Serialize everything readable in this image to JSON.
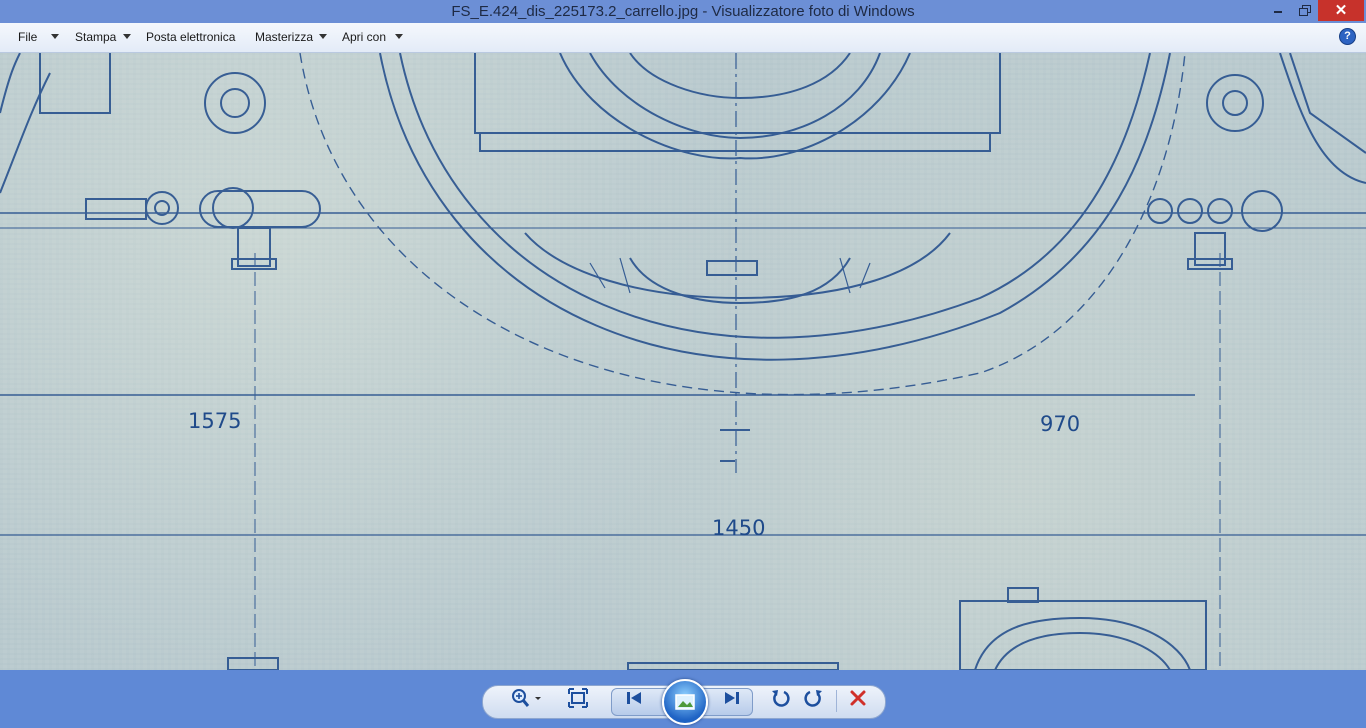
{
  "window": {
    "title": "FS_E.424_dis_225173.2_carrello.jpg - Visualizzatore foto di Windows",
    "close_glyph": "✕"
  },
  "menu": {
    "items": [
      {
        "label": "File"
      },
      {
        "label": "Stampa"
      },
      {
        "label": "Posta elettronica"
      },
      {
        "label": "Masterizza"
      },
      {
        "label": "Apri con"
      }
    ],
    "help_glyph": "?"
  },
  "image": {
    "dimensions": [
      "1575",
      "970",
      "1450"
    ]
  },
  "toolbar": {
    "icons": [
      "zoom-icon",
      "actual-size-icon",
      "previous-icon",
      "slideshow-icon",
      "next-icon",
      "rotate-counterclockwise-icon",
      "rotate-clockwise-icon",
      "delete-icon"
    ]
  },
  "colors": {
    "title_bar": "#6c8fd6",
    "close_button": "#c7322b",
    "blueprint_ink": "#1f4a8a",
    "bottom_bar": "#5f89d6"
  }
}
